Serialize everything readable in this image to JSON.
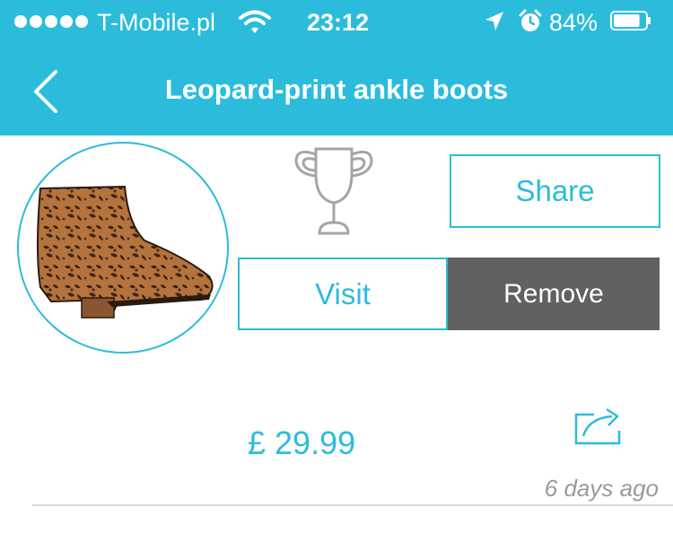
{
  "status_bar": {
    "carrier": "T-Mobile.pl",
    "time": "23:12",
    "battery_percent": "84%",
    "battery_level": 0.84,
    "signal_bars": 5,
    "icons": [
      "wifi-icon",
      "location-arrow-icon",
      "alarm-clock-icon",
      "battery-icon"
    ]
  },
  "nav": {
    "title": "Leopard-print ankle boots",
    "back_icon": "chevron-left-icon"
  },
  "product": {
    "image": "leopard-print-ankle-boot",
    "trophy_icon": "trophy-icon",
    "price": "£ 29.99",
    "timestamp": "6 days ago",
    "share_icon": "share-arrow-icon"
  },
  "actions": {
    "share_label": "Share",
    "visit_label": "Visit",
    "remove_label": "Remove"
  },
  "colors": {
    "accent": "#2bbcdb",
    "remove_bg": "#616161",
    "muted_text": "#9a9a9a",
    "divider": "#d9d9d9"
  }
}
